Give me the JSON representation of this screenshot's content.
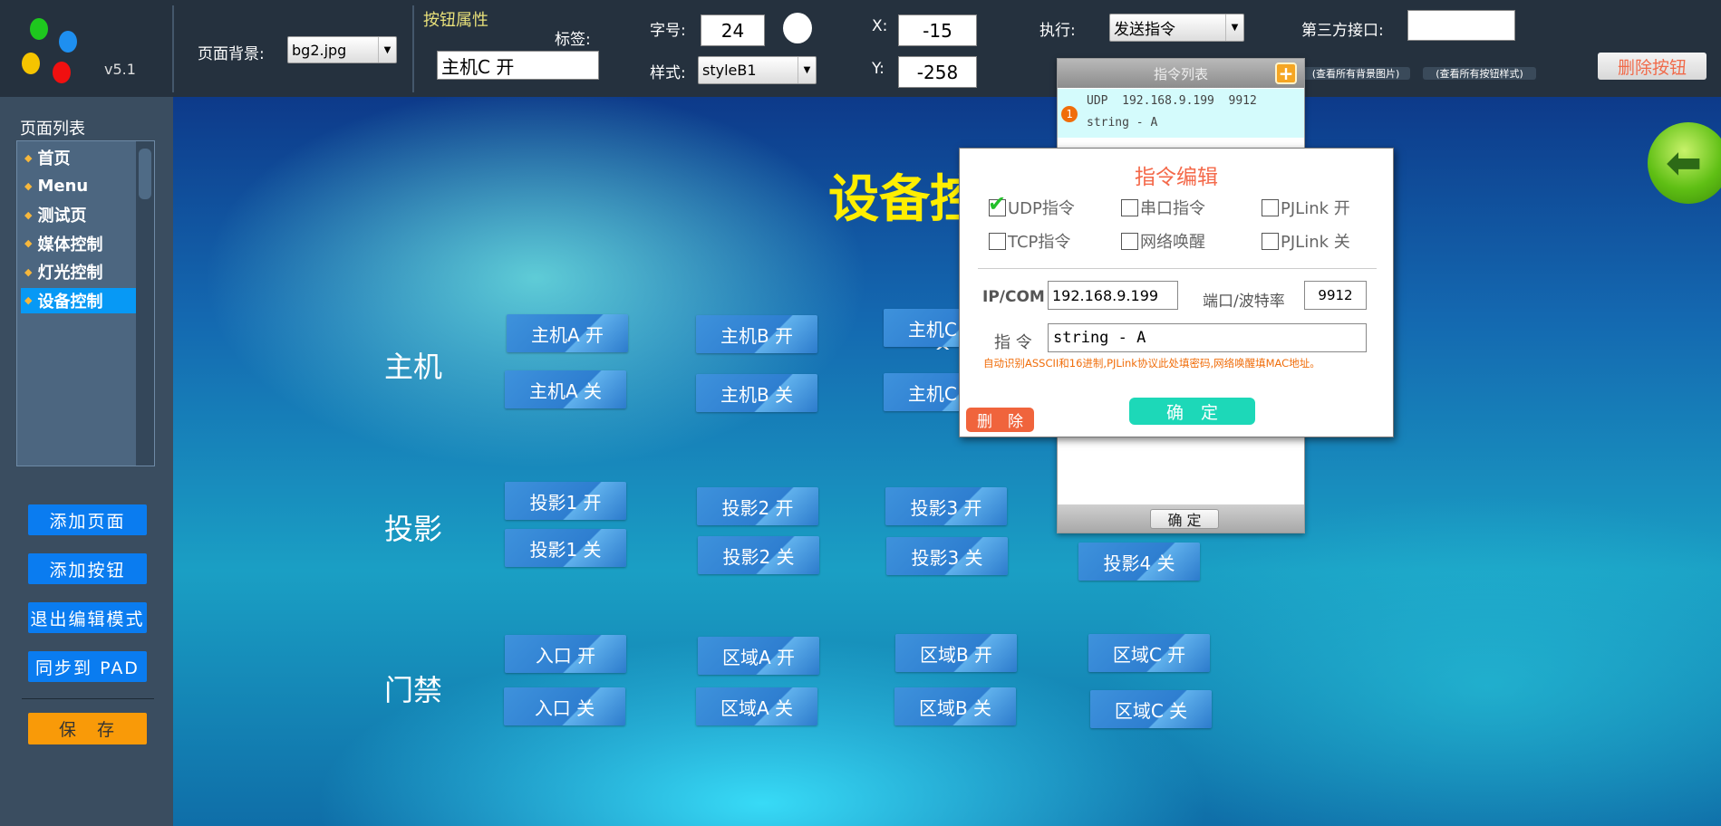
{
  "header": {
    "version": "v5.1",
    "bg_label": "页面背景:",
    "bg_value": "bg2.jpg",
    "props_title": "按钮属性",
    "tag_label": "标签:",
    "tag_value": "主机C 开",
    "font_label": "字号:",
    "font_value": "24",
    "style_label": "样式:",
    "style_value": "styleB1",
    "x_label": "X:",
    "x_value": "-15",
    "y_label": "Y:",
    "y_value": "-258",
    "exec_label": "执行:",
    "exec_value": "发送指令",
    "api_label": "第三方接口:",
    "api_value": "",
    "view_bg": "(查看所有背景图片)",
    "view_styles": "(查看所有按钮样式)",
    "delete_button": "删除按钮",
    "colors": {
      "dots": [
        "#1ec81e",
        "#1e8ff0",
        "#f5c400",
        "#f01010"
      ]
    }
  },
  "sidebar": {
    "title": "页面列表",
    "pages": [
      "首页",
      "Menu",
      "测试页",
      "媒体控制",
      "灯光控制",
      "设备控制"
    ],
    "selected": 5,
    "buttons": [
      "添加页面",
      "添加按钮",
      "退出编辑模式",
      "同步到 PAD"
    ],
    "save": "保　存"
  },
  "stage": {
    "title": "设备控制",
    "sections": [
      "主机",
      "投影",
      "门禁"
    ],
    "caret": "^",
    "buttons": [
      "主机A 开",
      "主机A 关",
      "主机B 开",
      "主机B 关",
      "主机C 开",
      "主机C 关",
      "投影1 开",
      "投影1 关",
      "投影2 开",
      "投影2 关",
      "投影3 开",
      "投影3 关",
      "投影4 关",
      "入口 开",
      "入口 关",
      "区域A 开",
      "区域A 关",
      "区域B 开",
      "区域B 关",
      "区域C 开",
      "区域C 关"
    ]
  },
  "cmd_list": {
    "title": "指令列表",
    "add": "+",
    "items": [
      {
        "num": "1",
        "line1": "UDP  192.168.9.199  9912",
        "line2": "string - A"
      }
    ],
    "ok": "确 定"
  },
  "cmd_edit": {
    "title": "指令编辑",
    "options": [
      {
        "label": "UDP指令",
        "checked": true
      },
      {
        "label": "串口指令",
        "checked": false
      },
      {
        "label": "PJLink 开",
        "checked": false
      },
      {
        "label": "TCP指令",
        "checked": false
      },
      {
        "label": "网络唤醒",
        "checked": false
      },
      {
        "label": "PJLink 关",
        "checked": false
      }
    ],
    "ip_label": "IP/COM",
    "ip_value": "192.168.9.199",
    "port_label": "端口/波特率",
    "port_value": "9912",
    "cmd_label": "指 令",
    "cmd_value": "string - A",
    "hint": "自动识别ASSCII和16进制,PJLink协议此处填密码,网络唤醒填MAC地址。",
    "ok": "确　定",
    "delete": "删　除"
  }
}
